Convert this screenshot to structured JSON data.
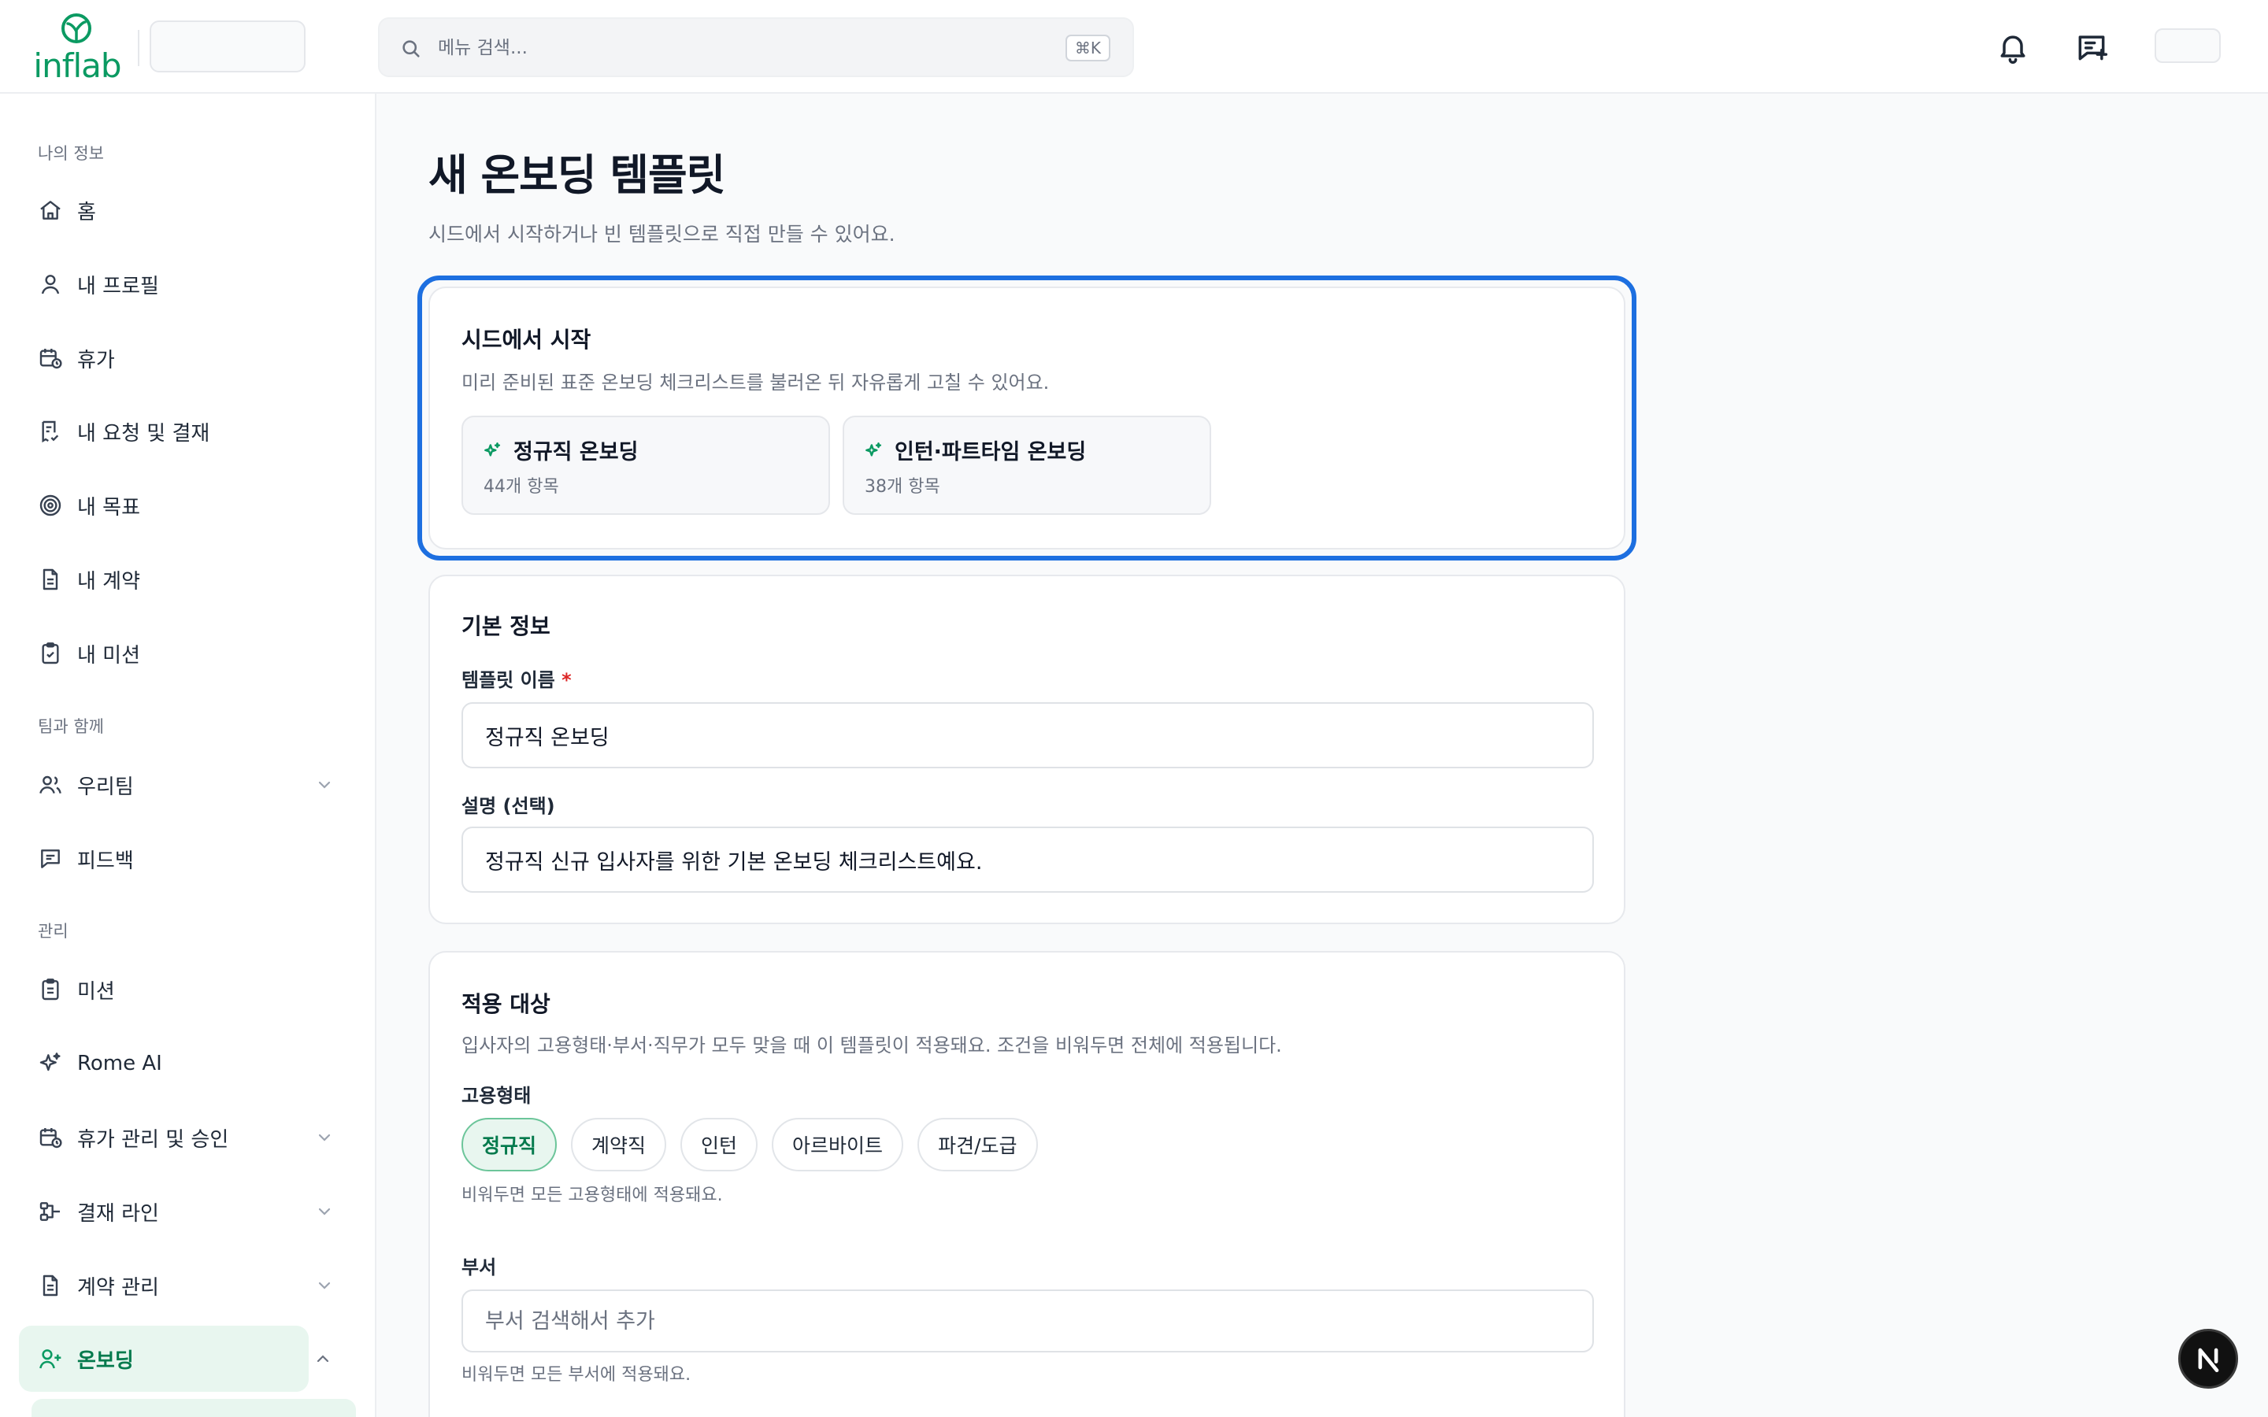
{
  "header": {
    "logo_text": "inflab",
    "search_placeholder": "메뉴 검색...",
    "search_shortcut": "⌘K"
  },
  "sidebar": {
    "sections": [
      {
        "label": "나의 정보",
        "items": [
          {
            "label": "홈",
            "icon": "home-icon"
          },
          {
            "label": "내 프로필",
            "icon": "user-icon"
          },
          {
            "label": "휴가",
            "icon": "calendar-clock-icon"
          },
          {
            "label": "내 요청 및 결재",
            "icon": "receipt-icon"
          },
          {
            "label": "내 목표",
            "icon": "target-icon"
          },
          {
            "label": "내 계약",
            "icon": "file-text-icon"
          },
          {
            "label": "내 미션",
            "icon": "clipboard-check-icon"
          }
        ]
      },
      {
        "label": "팀과 함께",
        "items": [
          {
            "label": "우리팀",
            "icon": "users-icon",
            "expandable": true
          },
          {
            "label": "피드백",
            "icon": "message-square-icon"
          }
        ]
      },
      {
        "label": "관리",
        "items": [
          {
            "label": "미션",
            "icon": "clipboard-list-icon"
          },
          {
            "label": "Rome AI",
            "icon": "sparkles-icon"
          },
          {
            "label": "휴가 관리 및 승인",
            "icon": "calendar-clock-icon",
            "expandable": true
          },
          {
            "label": "결재 라인",
            "icon": "git-branch-icon",
            "expandable": true
          },
          {
            "label": "계약 관리",
            "icon": "file-text-icon",
            "expandable": true
          },
          {
            "label": "온보딩",
            "icon": "user-plus-icon",
            "expandable": true,
            "active": true
          }
        ]
      }
    ]
  },
  "main": {
    "title": "새 온보딩 템플릿",
    "subtitle": "시드에서 시작하거나 빈 템플릿으로 직접 만들 수 있어요.",
    "seed": {
      "title": "시드에서 시작",
      "description": "미리 준비된 표준 온보딩 체크리스트를 불러온 뒤 자유롭게 고칠 수 있어요.",
      "options": [
        {
          "title": "정규직 온보딩",
          "count": "44개 항목"
        },
        {
          "title": "인턴·파트타임 온보딩",
          "count": "38개 항목"
        }
      ]
    },
    "basic": {
      "title": "기본 정보",
      "name_label": "템플릿 이름",
      "required_mark": "*",
      "name_value": "정규직 온보딩",
      "desc_label": "설명 (선택)",
      "desc_value": "정규직 신규 입사자를 위한 기본 온보딩 체크리스트예요."
    },
    "target": {
      "title": "적용 대상",
      "description": "입사자의 고용형태·부서·직무가 모두 맞을 때 이 템플릿이 적용돼요. 조건을 비워두면 전체에 적용됩니다.",
      "employment_label": "고용형태",
      "employment_types": [
        {
          "label": "정규직",
          "selected": true
        },
        {
          "label": "계약직",
          "selected": false
        },
        {
          "label": "인턴",
          "selected": false
        },
        {
          "label": "아르바이트",
          "selected": false
        },
        {
          "label": "파견/도급",
          "selected": false
        }
      ],
      "employment_hint": "비워두면 모든 고용형태에 적용돼요.",
      "department_label": "부서",
      "department_placeholder": "부서 검색해서 추가",
      "department_hint": "비워두면 모든 부서에 적용돼요."
    }
  },
  "colors": {
    "brand_green": "#0b9a62",
    "focus_blue": "#1d6fe0",
    "active_bg": "#e8f6ef"
  }
}
